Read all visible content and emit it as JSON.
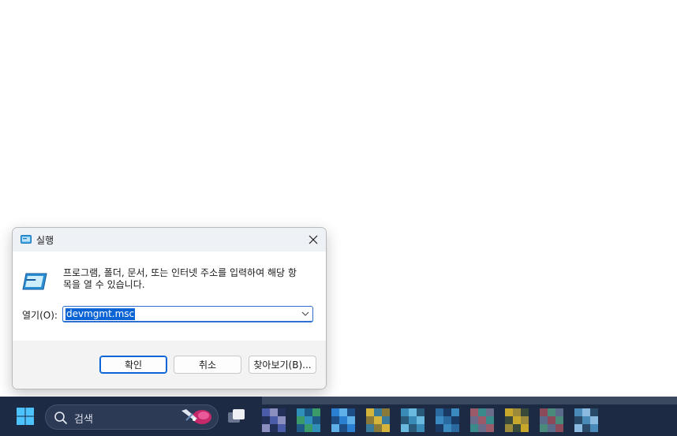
{
  "dialog": {
    "title": "실행",
    "description": "프로그램, 폴더, 문서, 또는 인터넷 주소를 입력하여 해당 항\n목을 열 수 있습니다.",
    "open_label": "열기(O):",
    "input_value": "devmgmt.msc",
    "buttons": {
      "ok": "확인",
      "cancel": "취소",
      "browse": "찾아보기(B)..."
    }
  },
  "taskbar": {
    "search_placeholder": "검색",
    "pinned_apps": [
      {
        "icon": "pixelated-app-icon",
        "colors": [
          "#4a5ca8",
          "#8a8fc0",
          "#23315a"
        ]
      },
      {
        "icon": "pixelated-app-icon",
        "colors": [
          "#2f8fb8",
          "#1e5a86",
          "#3a9a6a"
        ]
      },
      {
        "icon": "pixelated-app-icon",
        "colors": [
          "#2a7fd0",
          "#5fb0e8",
          "#1d4f86"
        ]
      },
      {
        "icon": "pixelated-app-icon",
        "colors": [
          "#d4b43a",
          "#3a7a9a",
          "#8a7a3a"
        ]
      },
      {
        "icon": "pixelated-app-icon",
        "colors": [
          "#3a8ab8",
          "#6abadf",
          "#2a5a7a"
        ]
      },
      {
        "icon": "pixelated-app-icon",
        "colors": [
          "#2a6aa0",
          "#1a3a66",
          "#3a8ac0"
        ]
      },
      {
        "icon": "pixelated-app-icon",
        "colors": [
          "#9a5a6a",
          "#3a8a8a",
          "#6a6a8a"
        ]
      },
      {
        "icon": "pixelated-app-icon",
        "colors": [
          "#c8a82a",
          "#9a8a3a",
          "#3a4a3a"
        ]
      },
      {
        "icon": "pixelated-app-icon",
        "colors": [
          "#8a4a5a",
          "#4a8a7a",
          "#5a6a8a"
        ]
      },
      {
        "icon": "pixelated-app-icon",
        "colors": [
          "#4a8ab8",
          "#8abadf",
          "#2a4a6a"
        ]
      }
    ]
  },
  "colors": {
    "accent": "#0a64d6",
    "titlebar": "#eef2f7",
    "taskbar": "#1d2a44"
  }
}
